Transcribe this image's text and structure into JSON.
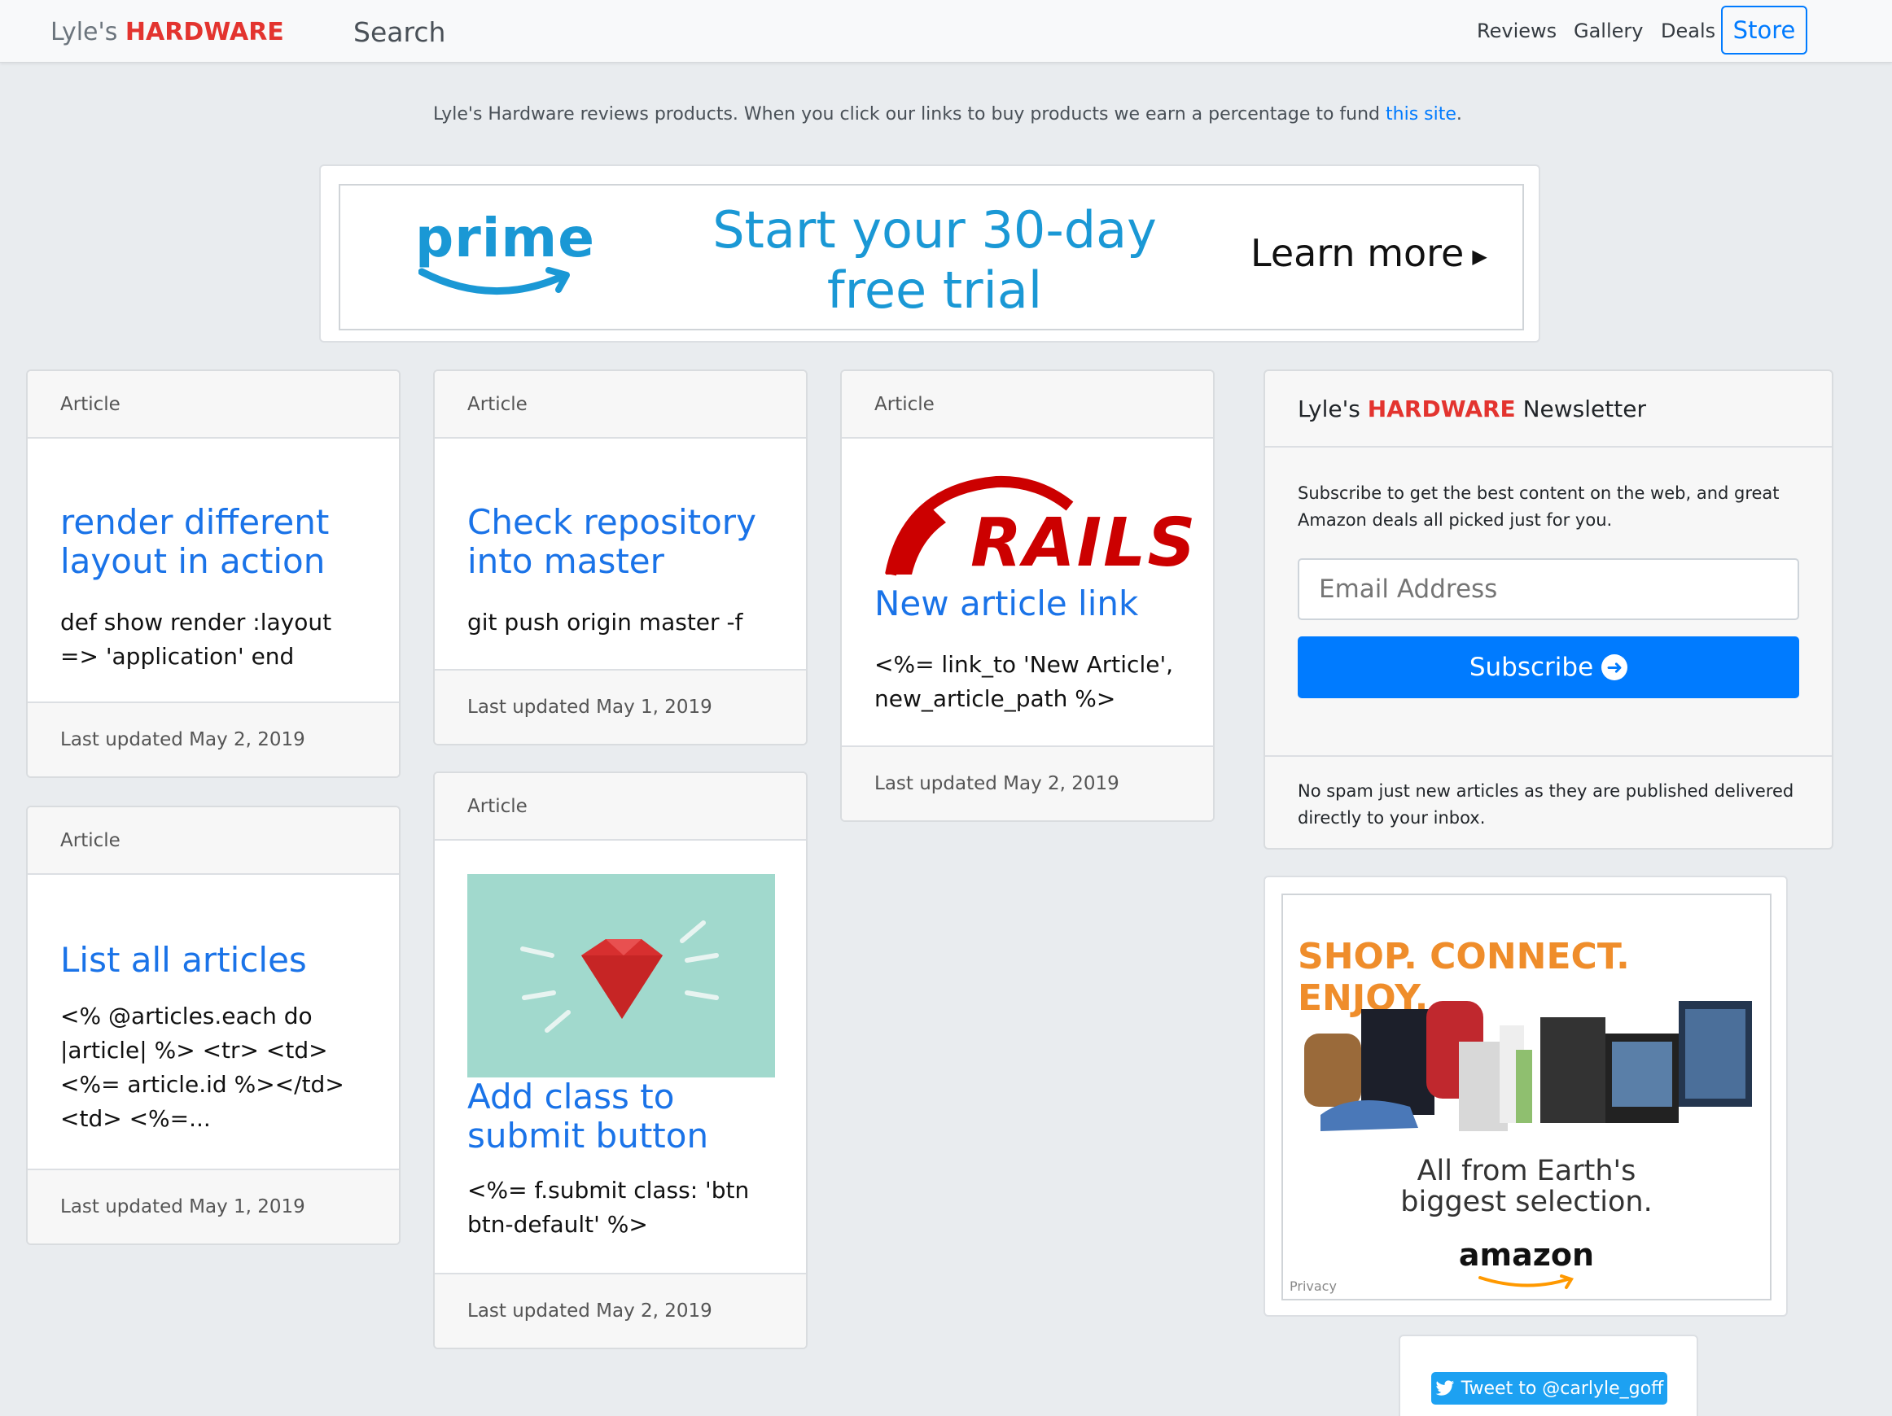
{
  "nav": {
    "brand_prefix": "Lyle's ",
    "brand_strong": "HARDWARE",
    "search": "Search",
    "links": [
      "Reviews",
      "Gallery",
      "Deals"
    ],
    "store": "Store"
  },
  "disclosure": {
    "text": "Lyle's Hardware reviews products. When you click our links to buy products we earn a percentage to fund ",
    "link": "this site",
    "end": "."
  },
  "banner": {
    "brand": "prime",
    "line1": "Start your 30-day",
    "line2": "free trial",
    "cta": "Learn more"
  },
  "articles": [
    {
      "header": "Article",
      "title": "render different layout in action",
      "body": "def show render :layout => 'application' end",
      "footer": "Last updated May 2, 2019"
    },
    {
      "header": "Article",
      "title": "List all articles",
      "body": "<% @articles.each do |article| %> <tr> <td><%= article.id %></td> <td> <%=...",
      "footer": "Last updated May 1, 2019"
    },
    {
      "header": "Article",
      "title": "Check repository into master",
      "body": "git push origin master -f",
      "footer": "Last updated May 1, 2019"
    },
    {
      "header": "Article",
      "title": "Add class to submit button",
      "body": "<%= f.submit class: 'btn btn-default' %>",
      "footer": "Last updated May 2, 2019"
    },
    {
      "header": "Article",
      "title": "New article link",
      "body": "<%= link_to 'New Article', new_article_path %>",
      "footer": "Last updated May 2, 2019",
      "image_text": "RAILS"
    }
  ],
  "newsletter": {
    "title_prefix": "Lyle's ",
    "title_strong": "HARDWARE",
    "title_suffix": " Newsletter",
    "text": "Subscribe to get the best content on the web, and great Amazon deals all picked just for you.",
    "email_placeholder": "Email Address",
    "button": "Subscribe",
    "footer": "No spam just new articles as they are published delivered directly to your inbox."
  },
  "ad": {
    "headline": "SHOP. CONNECT. ENJOY.",
    "line1": "All from Earth's",
    "line2": "biggest selection.",
    "brand": "amazon",
    "privacy": "Privacy"
  },
  "tweet": {
    "label": "Tweet to @carlyle_goff"
  },
  "colors": {
    "accent": "#007bff",
    "brand_red": "#e3342f",
    "prime_blue": "#1a98d5"
  }
}
